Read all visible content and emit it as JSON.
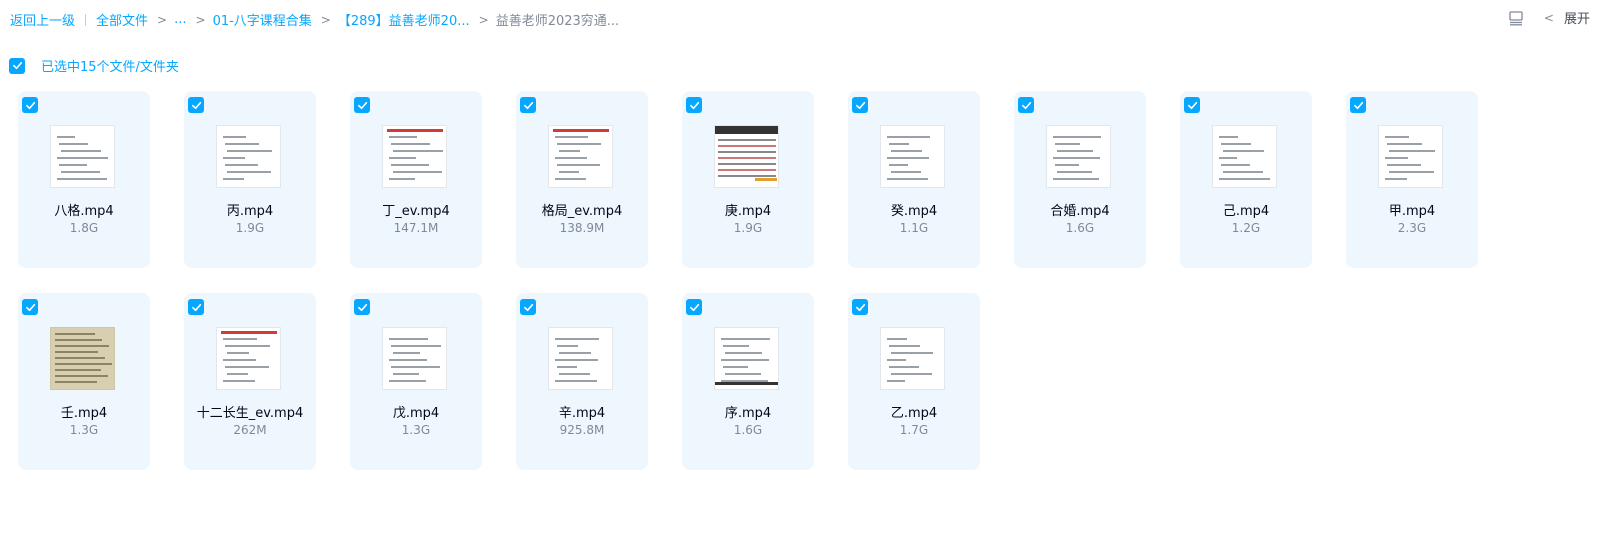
{
  "breadcrumb": {
    "back": "返回上一级",
    "all_files": "全部文件",
    "ellipsis": "...",
    "folder1": "01-八字课程合集",
    "folder2": "【289】益善老师20...",
    "current": "益善老师2023穷通..."
  },
  "toolbar": {
    "list_view_icon": "list-view-icon",
    "expand_label": "展开",
    "expand_icon": "chevron-left-icon"
  },
  "selection": {
    "label": "已选中15个文件/文件夹",
    "checked": true
  },
  "colors": {
    "accent": "#06a7ff",
    "card_bg": "#eef7fe",
    "muted": "#818999"
  },
  "files": [
    {
      "name": "八格.mp4",
      "size": "1.8G",
      "checked": true
    },
    {
      "name": "丙.mp4",
      "size": "1.9G",
      "checked": true
    },
    {
      "name": "丁_ev.mp4",
      "size": "147.1M",
      "checked": true
    },
    {
      "name": "格局_ev.mp4",
      "size": "138.9M",
      "checked": true
    },
    {
      "name": "庚.mp4",
      "size": "1.9G",
      "checked": true
    },
    {
      "name": "癸.mp4",
      "size": "1.1G",
      "checked": true
    },
    {
      "name": "合婚.mp4",
      "size": "1.6G",
      "checked": true
    },
    {
      "name": "己.mp4",
      "size": "1.2G",
      "checked": true
    },
    {
      "name": "甲.mp4",
      "size": "2.3G",
      "checked": true
    },
    {
      "name": "壬.mp4",
      "size": "1.3G",
      "checked": true
    },
    {
      "name": "十二长生_ev.mp4",
      "size": "262M",
      "checked": true
    },
    {
      "name": "戊.mp4",
      "size": "1.3G",
      "checked": true
    },
    {
      "name": "辛.mp4",
      "size": "925.8M",
      "checked": true
    },
    {
      "name": "序.mp4",
      "size": "1.6G",
      "checked": true
    },
    {
      "name": "乙.mp4",
      "size": "1.7G",
      "checked": true
    }
  ]
}
